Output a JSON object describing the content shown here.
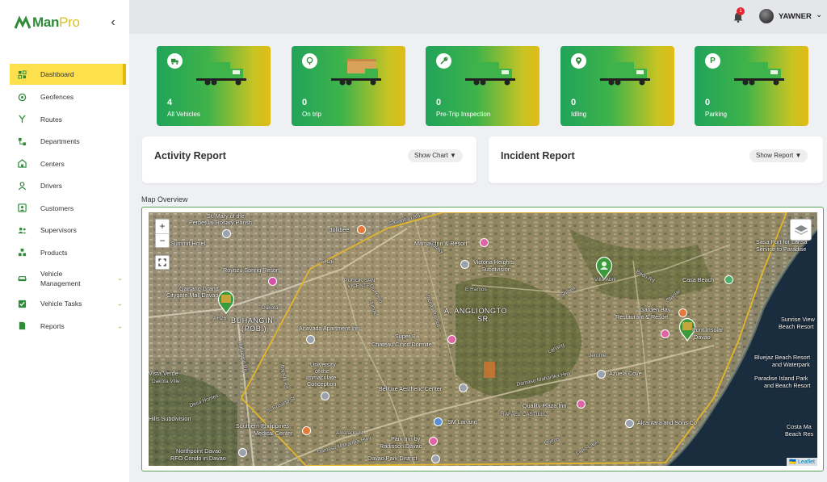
{
  "brand": {
    "name_man": "Man",
    "name_pro": "Pro"
  },
  "sidebar": {
    "collapse_icon": "chevron-left-icon",
    "items": [
      {
        "label": "Dashboard",
        "icon": "dashboard-icon",
        "active": true
      },
      {
        "label": "Geofences",
        "icon": "target-icon"
      },
      {
        "label": "Routes",
        "icon": "route-icon"
      },
      {
        "label": "Departments",
        "icon": "departments-icon"
      },
      {
        "label": "Centers",
        "icon": "building-icon"
      },
      {
        "label": "Drivers",
        "icon": "driver-icon"
      },
      {
        "label": "Customers",
        "icon": "customer-icon"
      },
      {
        "label": "Supervisors",
        "icon": "supervisor-icon"
      },
      {
        "label": "Products",
        "icon": "products-icon"
      },
      {
        "label": "Vehicle Management",
        "icon": "car-icon",
        "expandable": true
      },
      {
        "label": "Vehicle Tasks",
        "icon": "tasks-icon",
        "expandable": true
      },
      {
        "label": "Reports",
        "icon": "reports-icon",
        "expandable": true
      }
    ]
  },
  "topbar": {
    "notification_count": "1",
    "user_name": "YAWNER"
  },
  "stats": [
    {
      "value": "4",
      "label": "All Vehicles",
      "icon": "truck-icon"
    },
    {
      "value": "0",
      "label": "On trip",
      "icon": "location-pin-icon"
    },
    {
      "value": "0",
      "label": "Pre-Trip Inspection",
      "icon": "wrench-icon"
    },
    {
      "value": "0",
      "label": "Idling",
      "icon": "map-pin-icon"
    },
    {
      "value": "0",
      "label": "Parking",
      "icon": "parking-icon"
    }
  ],
  "activity_report": {
    "title": "Activity Report",
    "button": "Show Chart ▼"
  },
  "incident_report": {
    "title": "Incident Report",
    "button": "Show Report ▼"
  },
  "map": {
    "title": "Map Overview",
    "zoom_in": "+",
    "zoom_out": "−",
    "attribution": "Leaflet",
    "labels": {
      "l1": "St. Mary of the",
      "l2": "Perpetual Rosary Parish",
      "l3": "Summit Hotel",
      "l4": "Jollibee",
      "l5": "Royozu Spring Resort",
      "l6": "Gaisano Grand",
      "l7": "Citygate Mall Davao",
      "l8": "BUHANGIN",
      "l9": "(POB.)",
      "l10": "Anavada Apartment Inn",
      "l11": "Mamay Inn & Resort",
      "l12": "Victoria Heights",
      "l13": "Subdivision",
      "l14": "PUROK SAN",
      "l15": "VICENTE",
      "l16": "A. ANGLIONGTO",
      "l17": "SR.",
      "l18": "E Ramos",
      "l19": "Super 8",
      "l20": "Chateau Cinco Dormite",
      "l21": "University",
      "l22": "of the",
      "l23": "Immaculate",
      "l24": "Conception",
      "l25": "Belluxe Aesthetic Center",
      "l26": "Quality Plaza Inn",
      "l27": "RAFAEL CASTILLO",
      "l28": "Damaso Maharlika Hwy",
      "l29": "Azuela Cove",
      "l30": "Alcantara and Sons Co",
      "l31": "SM Lanang",
      "l32": "Park Inn by",
      "l33": "Radisson Davao",
      "l34": "Davao Park District",
      "l35": "Southern Philippines",
      "l36": "Medical Center",
      "l37": "Northpoint Davao",
      "l38": "RFO Condo in Davao",
      "l39": "Hills Subdivision",
      "l40": "Vista Verde",
      "l41": "Dakota Ville",
      "l42": "Garden Bay",
      "l43": "Restaurant & Resort",
      "l44": "Pont Insular",
      "l45": "Davao",
      "l46": "Casa Beach",
      "l47": "Sasa Port for Lansa",
      "l48": "Service to Paradise",
      "l49": "Sunrise View",
      "l50": "Beach Resort",
      "l51": "Bluejaz Beach Resort",
      "l52": "and Waterpark",
      "l53": "Paradise Island Park",
      "l54": "and Beach Resort",
      "l55": "Costa Ma",
      "l56": "Beach Res",
      "l57": "Cabantian Rd",
      "l58": "S. Rosario St",
      "l59": "Buhangin Rd",
      "l60": "Guerrero",
      "l61": "AH26",
      "l62": "Dakota",
      "l63": "Stanlar",
      "l64": "Bedu Rd",
      "l65": "Villa Abril",
      "l66": "Shibeli",
      "l67": "Lanang",
      "l68": "Jacinta Ramos",
      "l69": "Jungle",
      "l70": "Galaxy",
      "l71": "Bajada Rd",
      "l72": "Alvarado St",
      "l73": "Porras",
      "l74": "Lapu-Lapu",
      "l75": "Jerome",
      "l76": "Deca Homes"
    }
  }
}
